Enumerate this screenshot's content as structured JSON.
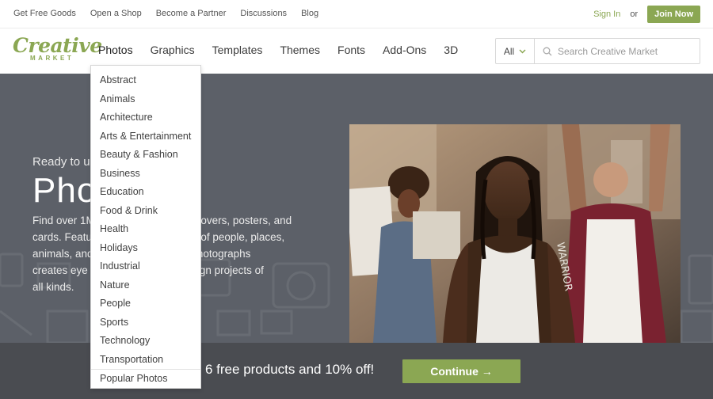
{
  "topbar": {
    "links": [
      "Get Free Goods",
      "Open a Shop",
      "Become a Partner",
      "Discussions",
      "Blog"
    ],
    "signin": "Sign In",
    "or": "or",
    "join": "Join Now"
  },
  "logo": {
    "main": "Creative",
    "sub": "MARKET"
  },
  "nav": {
    "items": [
      "Photos",
      "Graphics",
      "Templates",
      "Themes",
      "Fonts",
      "Add-Ons",
      "3D"
    ]
  },
  "search": {
    "scope": "All",
    "placeholder": "Search Creative Market"
  },
  "dropdown": {
    "categories": [
      "Abstract",
      "Animals",
      "Architecture",
      "Arts & Entertainment",
      "Beauty & Fashion",
      "Business",
      "Education",
      "Food & Drink",
      "Health",
      "Holidays",
      "Industrial",
      "Nature",
      "People",
      "Sports",
      "Technology",
      "Transportation"
    ],
    "footer_link": "Popular Photos"
  },
  "hero": {
    "kicker": "Ready to u",
    "title": "Pho",
    "desc_lines": [
      "Find over 1M                           ook covers, posters, and",
      "cards. Featu                        images of people, places,",
      "animals, and                        on of photographs",
      "creates eye                       s for design projects of",
      "all kinds."
    ]
  },
  "promo": {
    "text": "6 free products and 10% off!",
    "button": "Continue →"
  },
  "colors": {
    "brand_green": "#8ba753",
    "hero_bg": "#5c6068",
    "promo_bg": "#4a4c51"
  }
}
